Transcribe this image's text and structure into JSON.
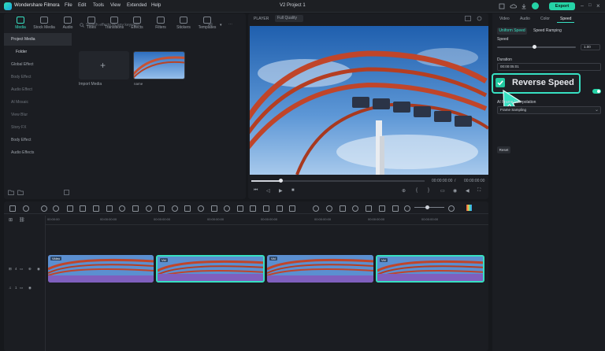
{
  "app": {
    "name": "Wondershare Filmora",
    "menu": [
      "File",
      "Edit",
      "Tools",
      "View",
      "Extended",
      "Help"
    ],
    "project_title": "V2 Project 1",
    "export_label": "Export",
    "accent": "#37e0c2"
  },
  "left_panel": {
    "tabs": [
      "Media",
      "Stock Media",
      "Audio",
      "Titles",
      "Transitions",
      "Effects",
      "Filters",
      "Stickers",
      "Templates"
    ],
    "active_tab": "Media",
    "sidebar": [
      "Project Media",
      "Folder",
      "Global Effect",
      "Body Effect",
      "Audio Effect",
      "AI Mosaic",
      "View Blur",
      "Story FX",
      "Body Effect",
      "Audio Effects"
    ],
    "search_placeholder": "Search effects by any keyword",
    "filter_label": "All",
    "import_label": "Import Media",
    "media_item_label": "name"
  },
  "player": {
    "label": "PLAYER",
    "quality": "Full Quality",
    "time_current": "00:00:00:00",
    "time_total": "00:00:00:00"
  },
  "right_panel": {
    "tabs": [
      "Video",
      "Audio",
      "Color",
      "Speed"
    ],
    "active_tab": "Speed",
    "subtabs": [
      "Uniform Speed",
      "Speed Ramping"
    ],
    "speed_label": "Speed",
    "speed_value": "1.00",
    "speed_fraction": 0.47,
    "duration_label": "Duration",
    "duration_value": "00:00:05:01",
    "reverse_speed_label": "Reverse Speed",
    "reverse_speed_checked": true,
    "ai_frame_label": "AI Frame Interpolation",
    "frame_option": "Frame Sampling",
    "reset_label": "Reset"
  },
  "timeline": {
    "ruler": [
      "00:00:00",
      "00:00:00:00",
      "00:00:00:00",
      "00:00:00:00",
      "00:00:00:00",
      "00:00:00:00",
      "00:00:00:00",
      "00:00:00:00"
    ],
    "video_track_label": "4",
    "audio_track_label": "1",
    "clips": [
      {
        "tag": "Video",
        "selected": false
      },
      {
        "tag": "Vid",
        "selected": true
      },
      {
        "tag": "Vid",
        "selected": false
      },
      {
        "tag": "Vid",
        "selected": true
      }
    ]
  }
}
